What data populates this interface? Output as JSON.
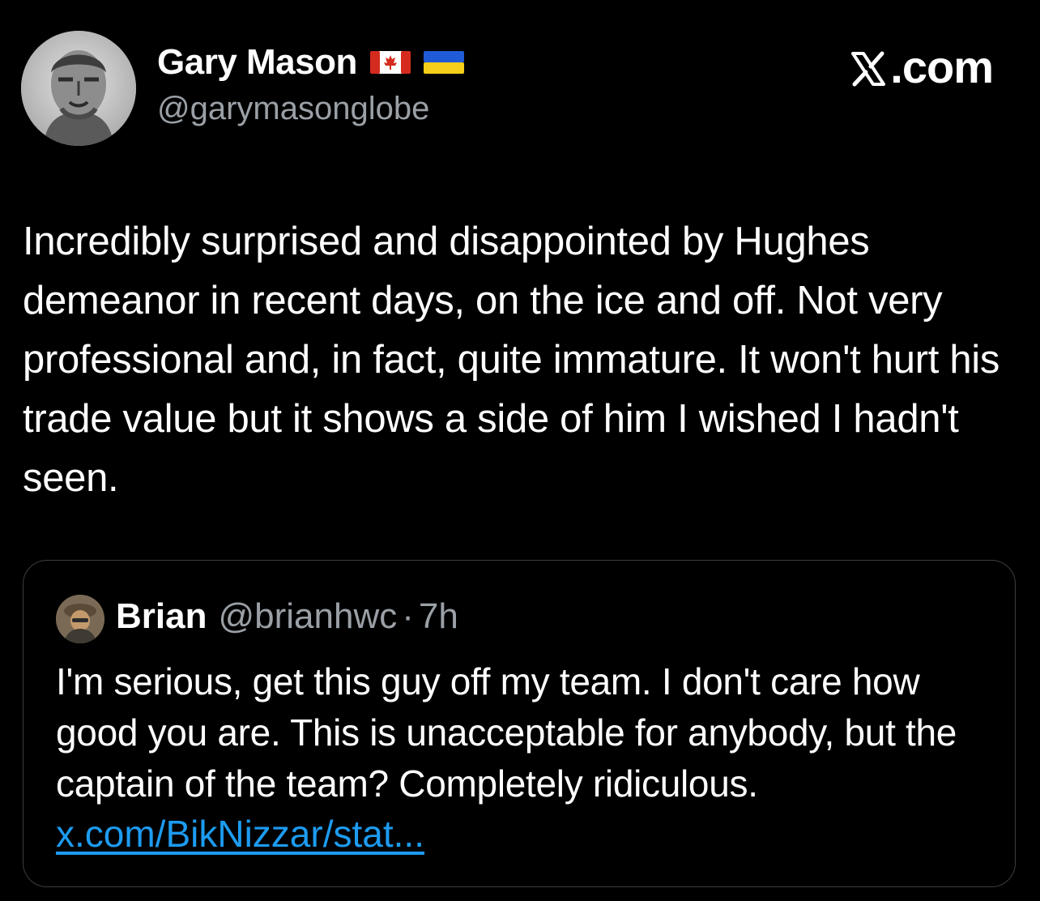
{
  "post": {
    "author_name": "Gary Mason",
    "author_handle": "@garymasonglobe",
    "flags": [
      "canada-flag-icon",
      "ukraine-flag-icon"
    ],
    "text": "Incredibly surprised and disappointed by Hughes demeanor in recent days, on the ice and off. Not very professional and, in fact, quite immature. It won't hurt his trade value but it shows a side of him I wished I hadn't seen."
  },
  "brand": {
    "label": ".com",
    "icon": "x-logo-icon"
  },
  "quoted_post": {
    "author_name": "Brian",
    "author_handle": "@brianhwc",
    "separator": "·",
    "time": "7h",
    "text": "I'm serious, get this guy off my team. I don't care how good you are. This is unacceptable for anybody, but the captain of the team? Completely ridiculous.",
    "link": "x.com/BikNizzar/stat..."
  },
  "colors": {
    "background": "#000000",
    "text": "#ffffff",
    "muted": "#9aa0a6",
    "link": "#1d9bf0",
    "border": "#3a3d41"
  }
}
